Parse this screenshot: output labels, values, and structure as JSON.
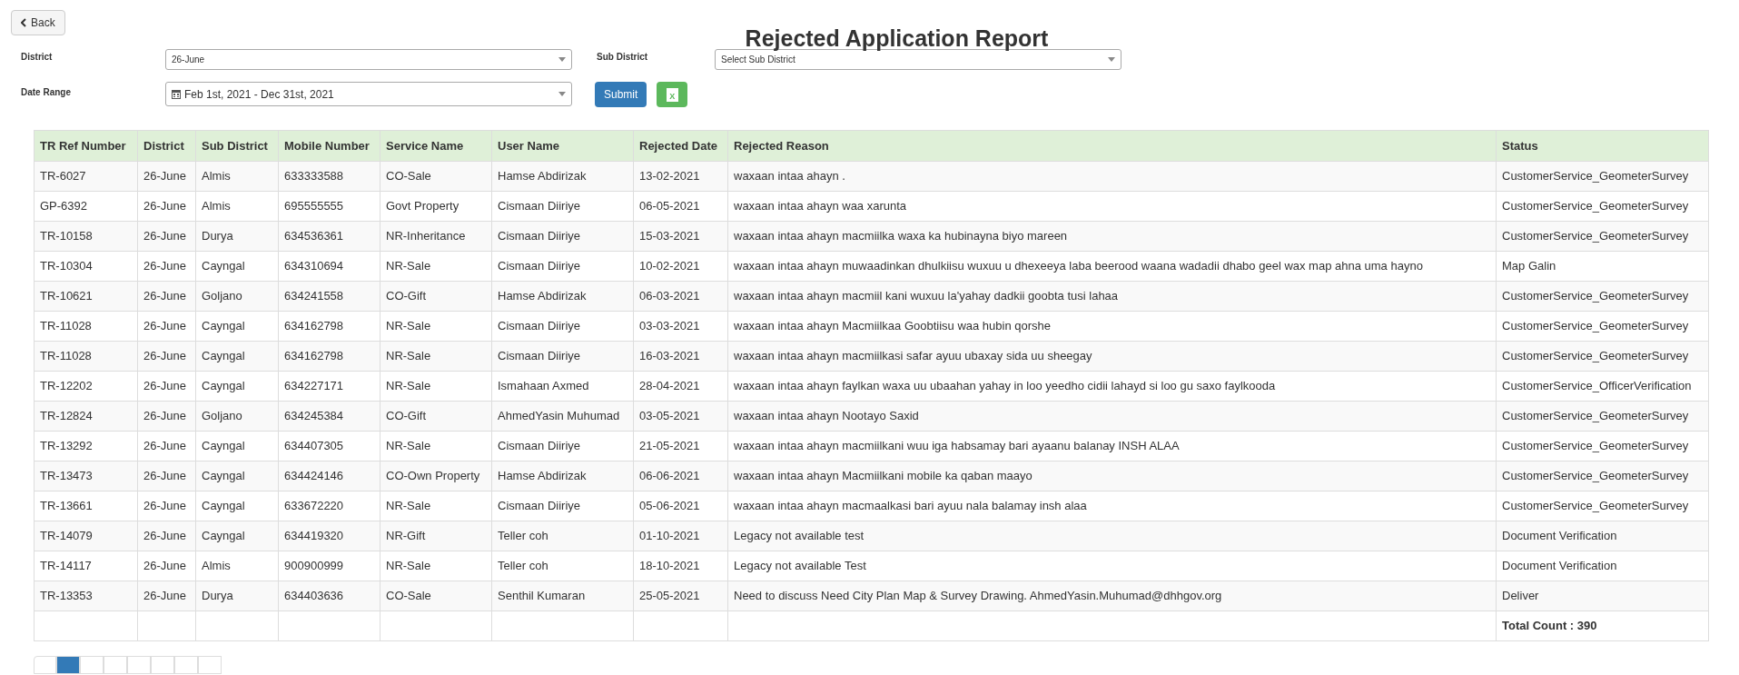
{
  "back_button": {
    "label": "Back"
  },
  "title": "Rejected Application Report",
  "filters": {
    "district": {
      "label": "District",
      "value": "26-June"
    },
    "sub_district": {
      "label": "Sub District",
      "value": "Select Sub District"
    },
    "date_range": {
      "label": "Date Range",
      "value": "Feb 1st, 2021 - Dec 31st, 2021"
    }
  },
  "submit_button": {
    "label": "Submit"
  },
  "excel_button": {
    "label": "X"
  },
  "table": {
    "columns": [
      "TR Ref Number",
      "District",
      "Sub District",
      "Mobile Number",
      "Service Name",
      "User Name",
      "Rejected Date",
      "Rejected Reason",
      "Status"
    ],
    "rows": [
      [
        "TR-6027",
        "26-June",
        "Almis",
        "633333588",
        "CO-Sale",
        "Hamse Abdirizak",
        "13-02-2021",
        "waxaan intaa ahayn .",
        "CustomerService_GeometerSurvey"
      ],
      [
        "GP-6392",
        "26-June",
        "Almis",
        "695555555",
        "Govt Property",
        "Cismaan Diiriye",
        "06-05-2021",
        "waxaan intaa ahayn waa xarunta",
        "CustomerService_GeometerSurvey"
      ],
      [
        "TR-10158",
        "26-June",
        "Durya",
        "634536361",
        "NR-Inheritance",
        "Cismaan Diiriye",
        "15-03-2021",
        "waxaan intaa ahayn macmiilka waxa ka hubinayna biyo mareen",
        "CustomerService_GeometerSurvey"
      ],
      [
        "TR-10304",
        "26-June",
        "Cayngal",
        "634310694",
        "NR-Sale",
        "Cismaan Diiriye",
        "10-02-2021",
        "waxaan intaa ahayn muwaadinkan dhulkiisu wuxuu u dhexeeya laba beerood waana wadadii dhabo geel wax map ahna uma hayno",
        "Map Galin"
      ],
      [
        "TR-10621",
        "26-June",
        "Goljano",
        "634241558",
        "CO-Gift",
        "Hamse Abdirizak",
        "06-03-2021",
        "waxaan intaa ahayn macmiil kani wuxuu la'yahay dadkii goobta tusi lahaa",
        "CustomerService_GeometerSurvey"
      ],
      [
        "TR-11028",
        "26-June",
        "Cayngal",
        "634162798",
        "NR-Sale",
        "Cismaan Diiriye",
        "03-03-2021",
        "waxaan intaa ahayn Macmiilkaa Goobtiisu waa hubin qorshe",
        "CustomerService_GeometerSurvey"
      ],
      [
        "TR-11028",
        "26-June",
        "Cayngal",
        "634162798",
        "NR-Sale",
        "Cismaan Diiriye",
        "16-03-2021",
        "waxaan intaa ahayn macmiilkasi safar ayuu ubaxay sida uu sheegay",
        "CustomerService_GeometerSurvey"
      ],
      [
        "TR-12202",
        "26-June",
        "Cayngal",
        "634227171",
        "NR-Sale",
        "Ismahaan Axmed",
        "28-04-2021",
        "waxaan intaa ahayn faylkan waxa uu ubaahan yahay in loo yeedho cidii lahayd si loo gu saxo faylkooda",
        "CustomerService_OfficerVerification"
      ],
      [
        "TR-12824",
        "26-June",
        "Goljano",
        "634245384",
        "CO-Gift",
        "AhmedYasin Muhumad",
        "03-05-2021",
        "waxaan intaa ahayn Nootayo Saxid",
        "CustomerService_GeometerSurvey"
      ],
      [
        "TR-13292",
        "26-June",
        "Cayngal",
        "634407305",
        "NR-Sale",
        "Cismaan Diiriye",
        "21-05-2021",
        "waxaan intaa ahayn macmiilkani wuu iga habsamay bari ayaanu balanay INSH ALAA",
        "CustomerService_GeometerSurvey"
      ],
      [
        "TR-13473",
        "26-June",
        "Cayngal",
        "634424146",
        "CO-Own Property",
        "Hamse Abdirizak",
        "06-06-2021",
        "waxaan intaa ahayn Macmiilkani mobile ka qaban maayo",
        "CustomerService_GeometerSurvey"
      ],
      [
        "TR-13661",
        "26-June",
        "Cayngal",
        "633672220",
        "NR-Sale",
        "Cismaan Diiriye",
        "05-06-2021",
        "waxaan intaa ahayn macmaalkasi bari ayuu nala balamay insh alaa",
        "CustomerService_GeometerSurvey"
      ],
      [
        "TR-14079",
        "26-June",
        "Cayngal",
        "634419320",
        "NR-Gift",
        "Teller coh",
        "01-10-2021",
        "Legacy not available test",
        "Document Verification"
      ],
      [
        "TR-14117",
        "26-June",
        "Almis",
        "900900999",
        "NR-Sale",
        "Teller coh",
        "18-10-2021",
        "Legacy not available Test",
        "Document Verification"
      ],
      [
        "TR-13353",
        "26-June",
        "Durya",
        "634403636",
        "CO-Sale",
        "Senthil Kumaran",
        "25-05-2021",
        "Need to discuss Need City Plan Map & Survey Drawing. AhmedYasin.Muhumad@dhhgov.org",
        "Deliver"
      ]
    ],
    "total": "Total Count : 390"
  },
  "pagination": [
    {
      "selected": false
    },
    {
      "selected": true
    },
    {
      "selected": false
    },
    {
      "selected": false
    },
    {
      "selected": false
    },
    {
      "selected": false
    },
    {
      "selected": false
    },
    {
      "selected": false
    }
  ]
}
